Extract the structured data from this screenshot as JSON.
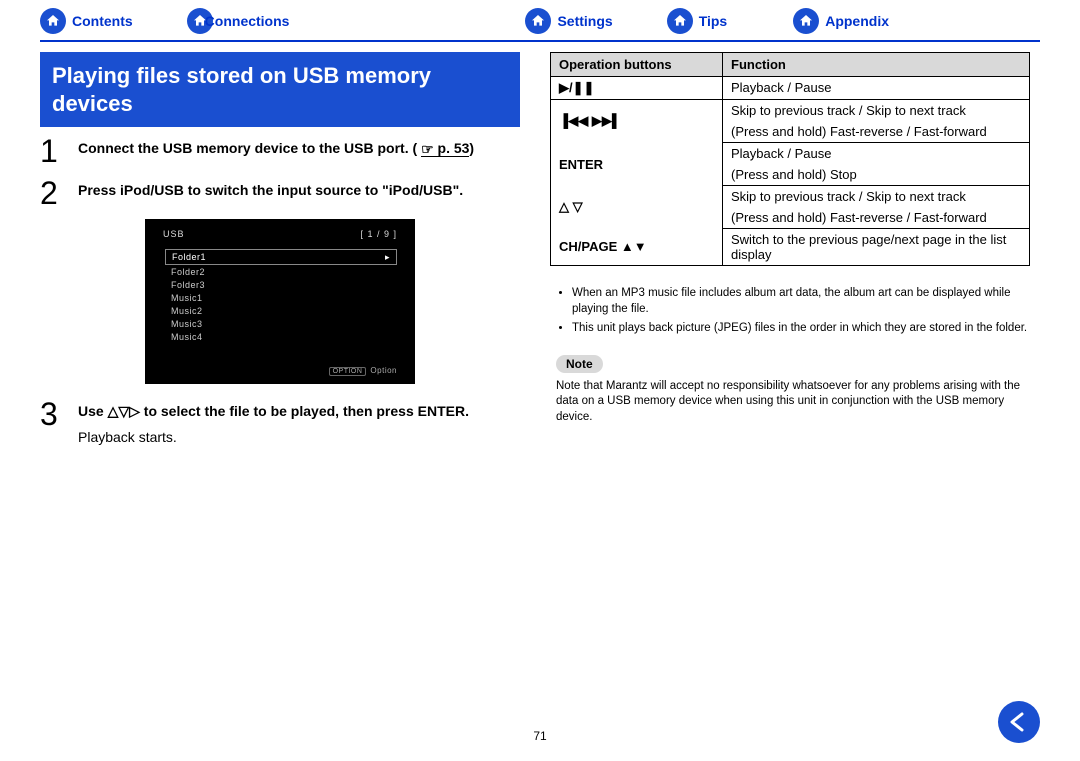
{
  "nav": {
    "contents": "Contents",
    "connections": "Connections",
    "settings": "Settings",
    "tips": "Tips",
    "appendix": "Appendix"
  },
  "title": "Playing files stored on USB memory devices",
  "steps": {
    "s1": {
      "num": "1",
      "text": "Connect the USB memory device to the USB port. (",
      "link": "p. 53",
      "text_after": ")"
    },
    "s2": {
      "num": "2",
      "text": "Press iPod/USB to switch the input source to \"iPod/USB\"."
    },
    "s3": {
      "num": "3",
      "text_a": "Use ",
      "text_b": " to select the file to be played, then press ENTER.",
      "sub": "Playback starts."
    }
  },
  "screen": {
    "title": "USB",
    "counter": "[ 1 / 9 ]",
    "items": [
      "Folder1",
      "Folder2",
      "Folder3",
      "Music1",
      "Music2",
      "Music3",
      "Music4"
    ],
    "option": "Option",
    "option_badge": "OPTION"
  },
  "table": {
    "h1": "Operation buttons",
    "h2": "Function",
    "rows": [
      {
        "btn_sym": "play_pause",
        "fn": "Playback / Pause"
      },
      {
        "btn_sym": "skip",
        "fn": "Skip to previous track / Skip to next track"
      },
      {
        "btn_sym": "",
        "fn": "(Press and hold) Fast-reverse / Fast-forward"
      },
      {
        "btn": "ENTER",
        "fn": "Playback / Pause"
      },
      {
        "btn_sym": "",
        "fn": "(Press and hold) Stop"
      },
      {
        "btn_sym": "updown",
        "fn": "Skip to previous track / Skip to next track"
      },
      {
        "btn_sym": "",
        "fn": "(Press and hold) Fast-reverse / Fast-forward"
      },
      {
        "btn": "CH/PAGE ▲▼",
        "fn": "Switch to the previous page/next page in the list display"
      }
    ]
  },
  "notes": {
    "bullet1": "When an MP3 music file includes album art data, the album art can be displayed while playing the file.",
    "bullet2": "This unit plays back picture (JPEG) files in the order in which they are stored in the folder.",
    "note_label": "Note",
    "note_text": "Note that Marantz will accept no responsibility whatsoever for any problems arising with the data on a USB memory device when using this unit in conjunction with the USB memory device."
  },
  "page_number": "71"
}
